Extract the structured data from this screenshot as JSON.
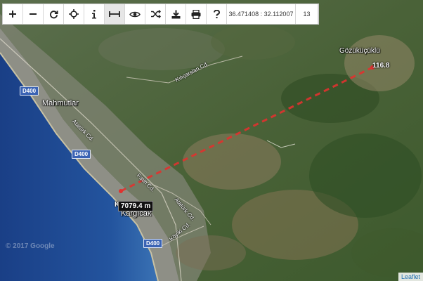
{
  "toolbar": {
    "buttons": [
      {
        "name": "zoom-in",
        "icon": "plus-icon"
      },
      {
        "name": "zoom-out",
        "icon": "minus-icon"
      },
      {
        "name": "refresh",
        "icon": "refresh-icon"
      },
      {
        "name": "locate",
        "icon": "crosshair-icon"
      },
      {
        "name": "info",
        "icon": "info-icon"
      },
      {
        "name": "measure",
        "icon": "measure-icon",
        "active": true
      },
      {
        "name": "view",
        "icon": "eye-icon"
      },
      {
        "name": "shuffle",
        "icon": "shuffle-icon"
      },
      {
        "name": "download",
        "icon": "download-icon"
      },
      {
        "name": "print",
        "icon": "print-icon"
      },
      {
        "name": "help",
        "icon": "question-icon"
      }
    ],
    "coordinates": "36.471408 : 32.112007",
    "zoom": "13"
  },
  "map": {
    "places": {
      "gozukuculu": "Gözüküçüklü",
      "mahmutlar": "Mahmutlar",
      "kargicak": "Kargıcak"
    },
    "roads": {
      "kilicarslan": "Kılıçarslan Cd.",
      "ataturk_upper": "Atatürk Cd.",
      "fatih": "Fatih Cd.",
      "ataturk_lower": "Atatürk Cd.",
      "koyiki": "Köyiki Cd."
    },
    "highways": {
      "d400_a": "D400",
      "d400_b": "D400",
      "d400_c": "D400"
    },
    "measure": {
      "distance": "7079.4 m",
      "end_label": "116.8",
      "start_fragment": "K"
    },
    "copyright": "© 2017 Google",
    "attribution": "Leaflet",
    "colors": {
      "sea": "#1f4f97",
      "measure_line": "#e0322f",
      "highway_badge": "#3b63b4"
    }
  }
}
